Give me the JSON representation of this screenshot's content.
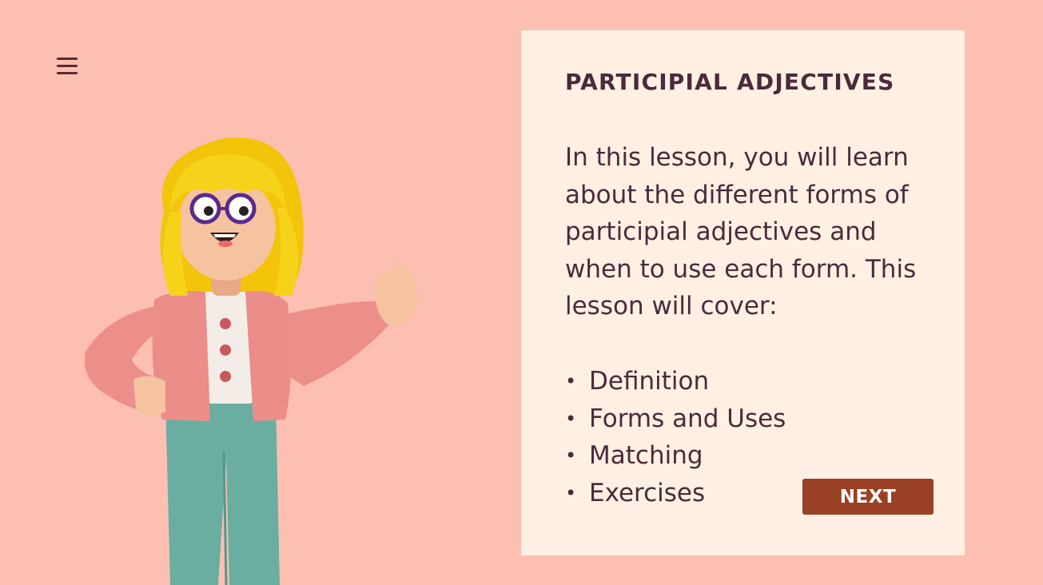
{
  "menu": {
    "icon": "hamburger-menu-icon"
  },
  "illustration": {
    "subject": "3d-cartoon-woman-pointing"
  },
  "lesson": {
    "title": "PARTICIPIAL ADJECTIVES",
    "intro": "In this lesson, you will learn about the different forms of participial adjectives and when to use each form. This lesson will cover:",
    "topics": [
      "Definition",
      "Forms and Uses",
      "Matching",
      "Exercises"
    ],
    "bullet": "•",
    "next_label": "NEXT"
  },
  "colors": {
    "background": "#fdbfb2",
    "panel": "#fff0e3",
    "text": "#4b2a3b",
    "button": "#9a4024"
  }
}
